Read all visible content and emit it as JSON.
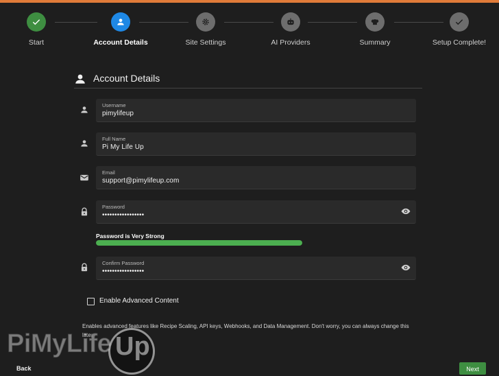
{
  "stepper": {
    "steps": [
      {
        "label": "Start",
        "state": "done",
        "icon": "check-icon"
      },
      {
        "label": "Account Details",
        "state": "active",
        "icon": "person-icon"
      },
      {
        "label": "Site Settings",
        "state": "pending",
        "icon": "gear-icon"
      },
      {
        "label": "AI Providers",
        "state": "pending",
        "icon": "robot-icon"
      },
      {
        "label": "Summary",
        "state": "pending",
        "icon": "chef-hat-icon"
      },
      {
        "label": "Setup Complete!",
        "state": "pending",
        "icon": "check-icon"
      }
    ]
  },
  "section": {
    "title": "Account Details",
    "icon": "person-icon"
  },
  "fields": {
    "username": {
      "label": "Username",
      "value": "pimylifeup",
      "icon": "person-icon"
    },
    "full_name": {
      "label": "Full Name",
      "value": "Pi My Life Up",
      "icon": "person-icon"
    },
    "email": {
      "label": "Email",
      "value": "support@pimylifeup.com",
      "icon": "envelope-icon"
    },
    "password": {
      "label": "Password",
      "value": "•••••••••••••••••",
      "icon": "lock-icon"
    },
    "confirm_password": {
      "label": "Confirm Password",
      "value": "•••••••••••••••••",
      "icon": "lock-icon"
    }
  },
  "password_strength": {
    "label": "Password is Very Strong",
    "level": 1.0,
    "color": "#4caf50"
  },
  "advanced": {
    "checkbox_label": "Enable Advanced Content",
    "checked": false,
    "description": "Enables advanced features like Recipe Scaling, API keys, Webhooks, and Data Management. Don't worry, you can always change this later"
  },
  "watermark": {
    "text": "PiMyLife",
    "badge": "Up"
  },
  "nav": {
    "back_label": "Back",
    "next_label": "Next"
  },
  "colors": {
    "accent": "#e07b39",
    "active": "#1e88e5",
    "success": "#3e8e41"
  }
}
